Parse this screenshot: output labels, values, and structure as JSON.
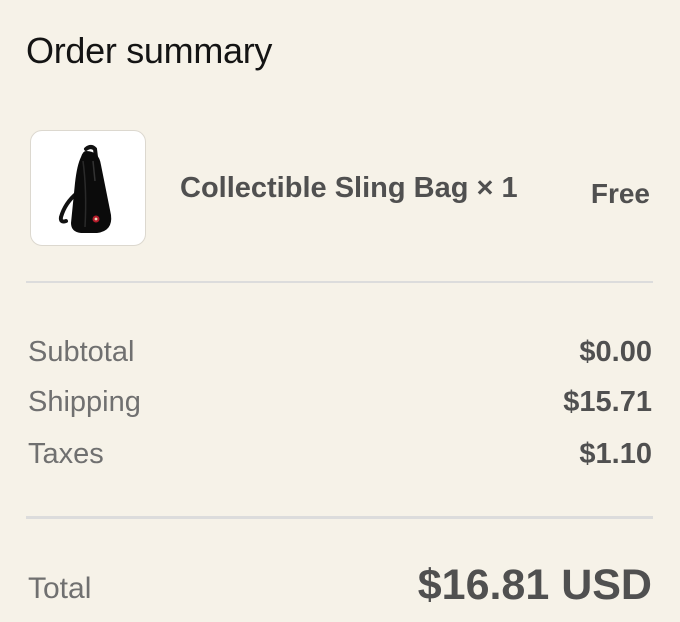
{
  "title": "Order summary",
  "item": {
    "name": "Collectible Sling Bag × 1",
    "price": "Free",
    "image_icon": "sling-bag-icon"
  },
  "costs": [
    {
      "label": "Subtotal",
      "value": "$0.00"
    },
    {
      "label": "Shipping",
      "value": "$15.71"
    },
    {
      "label": "Taxes",
      "value": "$1.10"
    }
  ],
  "total": {
    "label": "Total",
    "value": "$16.81 USD"
  },
  "colors": {
    "background": "#f6f2e8",
    "title": "#141414",
    "text_strong": "#505050",
    "text_muted": "#707070",
    "divider": "#dcdcdc"
  }
}
